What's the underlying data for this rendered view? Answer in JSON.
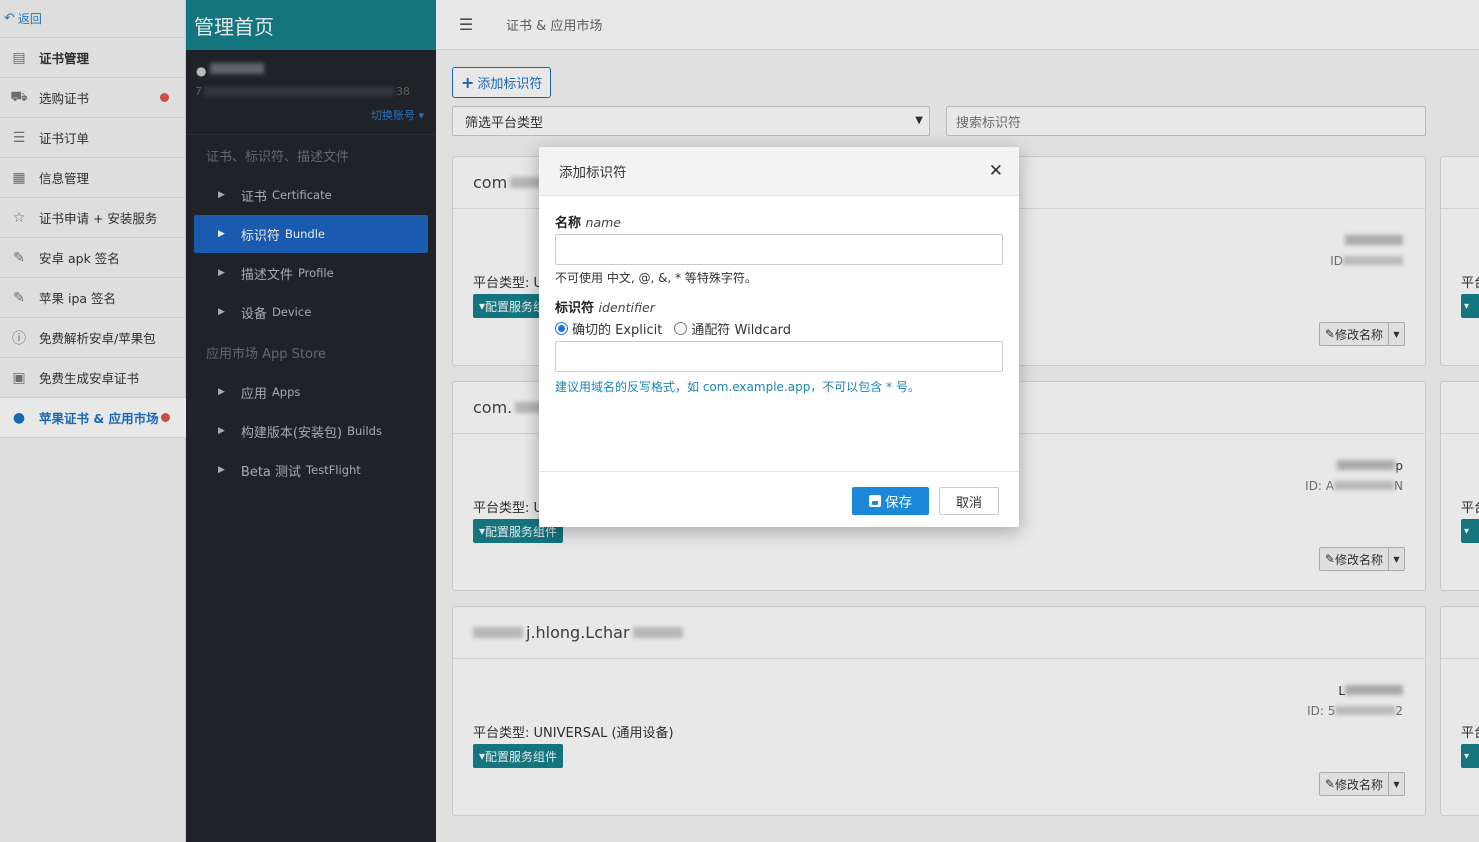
{
  "left": {
    "back_label": "返回",
    "items": [
      {
        "label": "证书管理",
        "icon": "certificate-icon",
        "bold": true
      },
      {
        "label": "选购证书",
        "icon": "cart-icon",
        "dot": true
      },
      {
        "label": "证书订单",
        "icon": "order-list-icon"
      },
      {
        "label": "信息管理",
        "icon": "info-manage-icon"
      },
      {
        "label": "证书申请 + 安装服务",
        "icon": "star-badge-icon"
      },
      {
        "label": "安卓 apk 签名",
        "icon": "pen-icon"
      },
      {
        "label": "苹果 ipa 签名",
        "icon": "pen-icon"
      },
      {
        "label": "免费解析安卓/苹果包",
        "icon": "info-circle-icon"
      },
      {
        "label": "免费生成安卓证书",
        "icon": "clipboard-icon"
      },
      {
        "label": "苹果证书 & 应用市场",
        "icon": "apple-icon",
        "active": true,
        "dot": true
      }
    ]
  },
  "nav": {
    "brand": "管理首页",
    "account_prefix": "7",
    "account_suffix": "38",
    "switch_label": "切换账号",
    "groups": [
      {
        "title": "证书、标识符、描述文件",
        "items": [
          {
            "cn": "证书",
            "en": "Certificate"
          },
          {
            "cn": "标识符",
            "en": "Bundle",
            "active": true
          },
          {
            "cn": "描述文件",
            "en": "Profile"
          },
          {
            "cn": "设备",
            "en": "Device"
          }
        ]
      },
      {
        "title": "应用市场 App Store",
        "items": [
          {
            "cn": "应用",
            "en": "Apps"
          },
          {
            "cn": "构建版本(安装包)",
            "en": "Builds"
          },
          {
            "cn": "Beta 测试",
            "en": "TestFlight"
          }
        ]
      }
    ]
  },
  "main": {
    "breadcrumb": "证书 & 应用市场",
    "add_button": "添加标识符",
    "filter_label": "筛选平台类型",
    "search_placeholder": "搜索标识符",
    "cards": [
      {
        "title": "com",
        "id_prefix": "ID",
        "platform": "平台类型: U",
        "config": "配置服务组件",
        "rename": "修改名称"
      },
      {
        "title": "com.",
        "id_prefix": "ID: A",
        "id_suffix": "N",
        "name_suffix": "p",
        "platform": "平台类型: U",
        "config": "配置服务组件",
        "rename": "修改名称"
      },
      {
        "title": "j.hlong.Lchar",
        "id_prefix": "ID: 5",
        "id_suffix": "2",
        "name_prefix": "L",
        "platform": "平台类型: UNIVERSAL (通用设备)",
        "config": "配置服务组件",
        "rename": "修改名称"
      }
    ],
    "side_platform": "平台"
  },
  "modal": {
    "title": "添加标识符",
    "name_label": "名称",
    "name_label_en": "name",
    "name_hint": "不可使用 中文, @, &, * 等特殊字符。",
    "identifier_label": "标识符",
    "identifier_label_en": "identifier",
    "radio_explicit": "确切的 Explicit",
    "radio_wildcard": "通配符 Wildcard",
    "identifier_tip": "建议用域名的反写格式，如 com.example.app，不可以包含 * 号。",
    "save_label": "保存",
    "cancel_label": "取消"
  }
}
